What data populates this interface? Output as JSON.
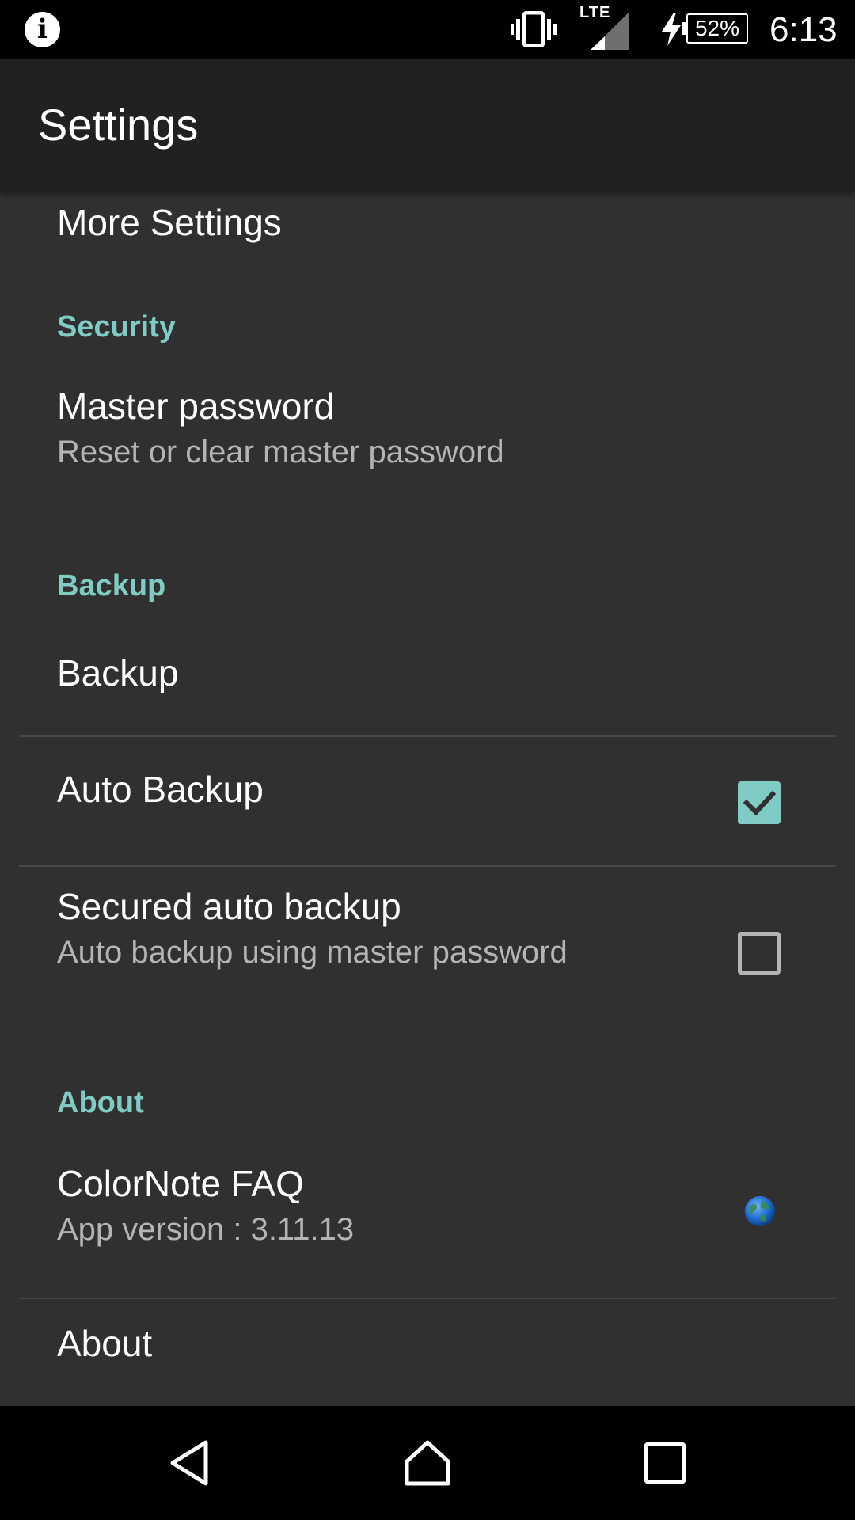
{
  "status_bar": {
    "left_icon": "info-icon",
    "network": "LTE",
    "battery_level": "52%",
    "time": "6:13"
  },
  "app_bar": {
    "title": "Settings"
  },
  "settings": {
    "more_settings": "More Settings",
    "security": {
      "header": "Security",
      "master_password": {
        "title": "Master password",
        "summary": "Reset or clear master password"
      }
    },
    "backup": {
      "header": "Backup",
      "backup_item": {
        "title": "Backup"
      },
      "auto_backup": {
        "title": "Auto Backup",
        "checked": true
      },
      "secured_auto_backup": {
        "title": "Secured auto backup",
        "summary": "Auto backup using master password",
        "checked": false
      }
    },
    "about": {
      "header": "About",
      "faq": {
        "title": "ColorNote FAQ",
        "summary": "App version : 3.11.13",
        "icon": "globe-icon"
      },
      "about_item": {
        "title": "About"
      }
    }
  },
  "nav_bar": {
    "back": "back-icon",
    "home": "home-icon",
    "recents": "recents-icon"
  },
  "colors": {
    "accent": "#80cbc4",
    "background": "#303030",
    "app_bar": "#212121"
  }
}
